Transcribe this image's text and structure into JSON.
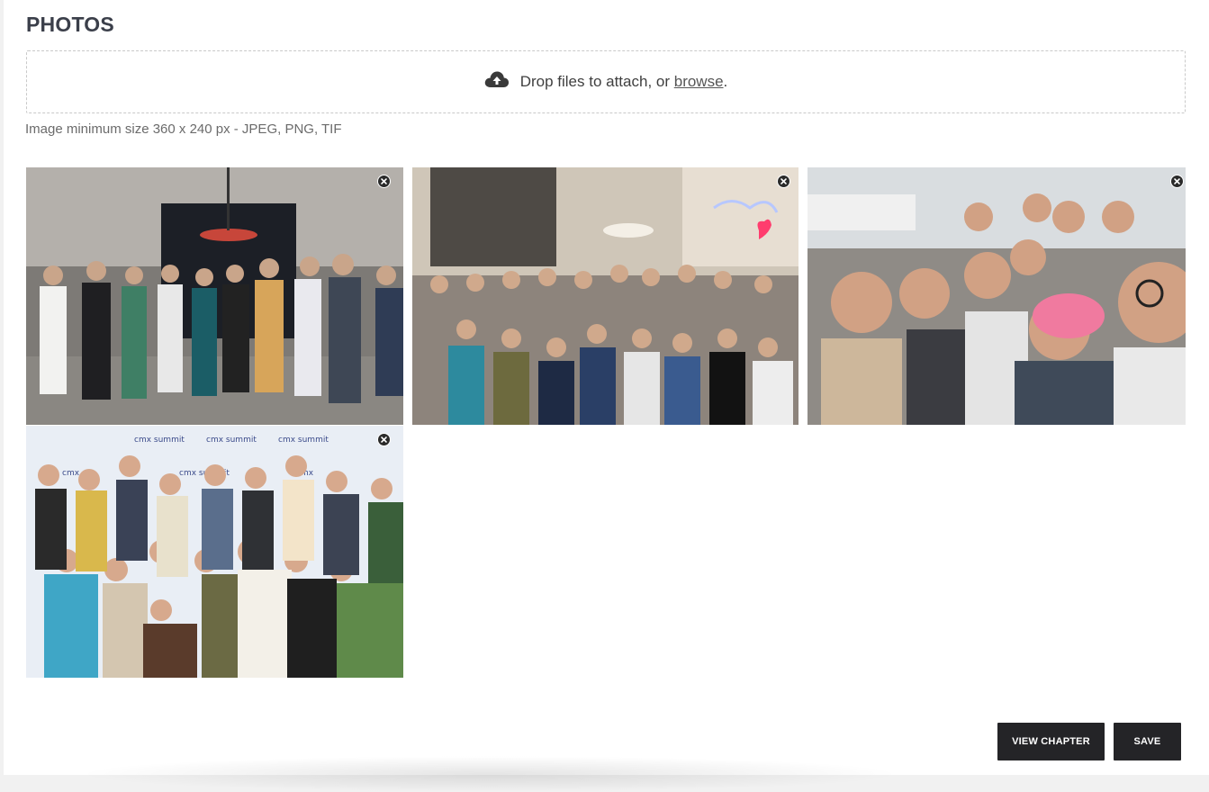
{
  "section": {
    "title": "PHOTOS"
  },
  "dropzone": {
    "icon": "cloud-upload-icon",
    "text": "Drop files to attach, or ",
    "browse_label": "browse",
    "suffix": "."
  },
  "hint": "Image minimum size 360 x 240 px - JPEG, PNG, TIF",
  "photos": [
    {
      "description_icon": "group-photo",
      "remove_icon": "close-icon"
    },
    {
      "description_icon": "group-photo",
      "remove_icon": "close-icon"
    },
    {
      "description_icon": "group-photo",
      "remove_icon": "close-icon"
    },
    {
      "description_icon": "group-photo",
      "remove_icon": "close-icon"
    }
  ],
  "actions": {
    "view_chapter_label": "VIEW CHAPTER",
    "save_label": "SAVE"
  },
  "colors": {
    "button_bg": "#242427",
    "title": "#3b3f4a"
  }
}
